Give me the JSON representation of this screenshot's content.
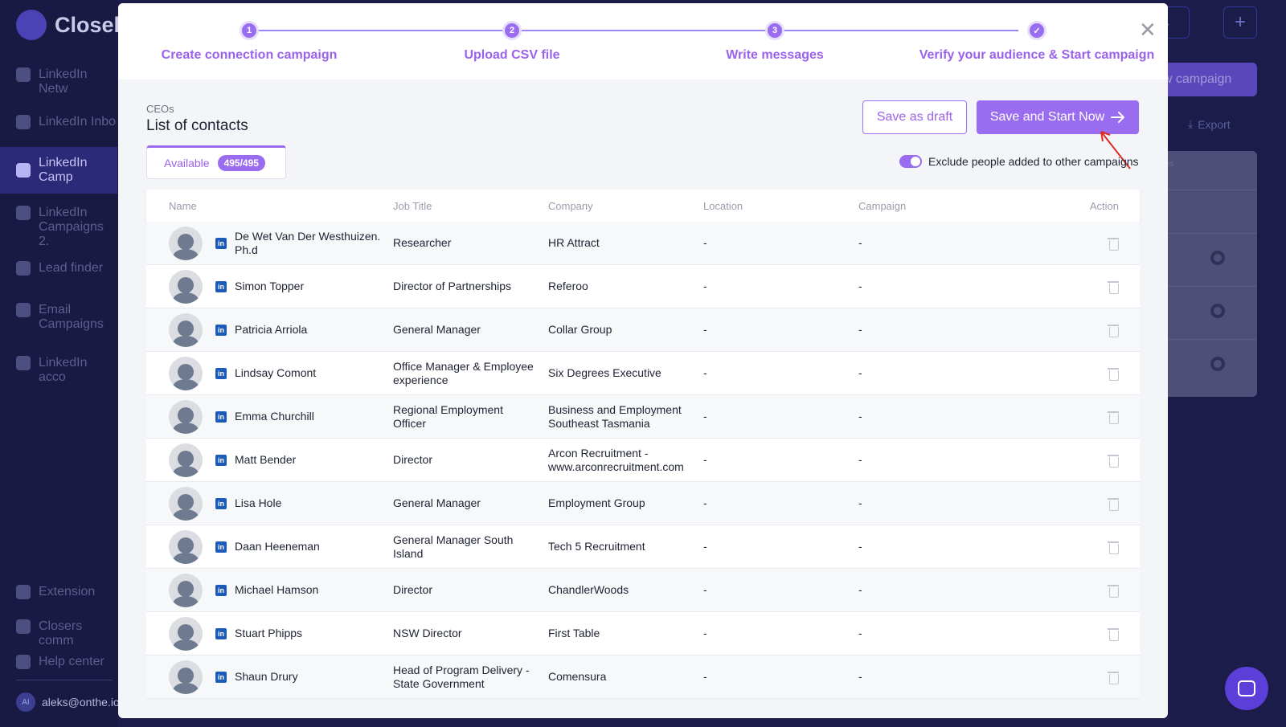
{
  "app": {
    "logo_text": "Closel"
  },
  "sidebar": {
    "items": [
      {
        "label": "LinkedIn Netw"
      },
      {
        "label": "LinkedIn Inbo"
      },
      {
        "label": "LinkedIn Camp"
      },
      {
        "label": "LinkedIn Campaigns 2."
      },
      {
        "label": "Lead finder"
      },
      {
        "label": "Email Campaigns"
      },
      {
        "label": "LinkedIn acco"
      },
      {
        "label": "Extension"
      },
      {
        "label": "Closers comm"
      },
      {
        "label": "Help center"
      }
    ],
    "user": {
      "initials": "AI",
      "email": "aleks@onthe.io"
    }
  },
  "background": {
    "new_campaign_label": "ew campaign",
    "export_label": "Export",
    "card_text": "sages\nded"
  },
  "stepper": {
    "steps": [
      {
        "number": "1",
        "label": "Create connection campaign"
      },
      {
        "number": "2",
        "label": "Upload CSV file"
      },
      {
        "number": "3",
        "label": "Write messages"
      },
      {
        "number": "✓",
        "label": "Verify your audience & Start campaign"
      }
    ]
  },
  "list": {
    "category": "CEOs",
    "title": "List of contacts",
    "tab_label": "Available",
    "tab_count": "495/495"
  },
  "actions": {
    "save_draft": "Save as draft",
    "save_start": "Save and Start Now",
    "exclude_label": "Exclude people added to other campaigns",
    "exclude_enabled": true
  },
  "colors": {
    "accent": "#9a6cf0",
    "linkedin": "#1e5bb8",
    "annotation_arrow": "#e02b20"
  },
  "table": {
    "headers": {
      "name": "Name",
      "job": "Job Title",
      "company": "Company",
      "location": "Location",
      "campaign": "Campaign",
      "action": "Action"
    },
    "rows": [
      {
        "name": "De Wet Van Der Westhuizen. Ph.d",
        "job": "Researcher",
        "company": "HR Attract",
        "location": "-",
        "campaign": "-"
      },
      {
        "name": "Simon Topper",
        "job": "Director of Partnerships",
        "company": "Referoo",
        "location": "-",
        "campaign": "-"
      },
      {
        "name": "Patricia Arriola",
        "job": "General Manager",
        "company": "Collar Group",
        "location": "-",
        "campaign": "-"
      },
      {
        "name": "Lindsay Comont",
        "job": "Office Manager & Employee experience",
        "company": "Six Degrees Executive",
        "location": "-",
        "campaign": "-"
      },
      {
        "name": "Emma Churchill",
        "job": "Regional Employment Officer",
        "company": "Business and Employment Southeast Tasmania",
        "location": "-",
        "campaign": "-"
      },
      {
        "name": "Matt Bender",
        "job": "Director",
        "company": "Arcon Recruitment - www.arconrecruitment.com",
        "location": "-",
        "campaign": "-"
      },
      {
        "name": "Lisa Hole",
        "job": "General Manager",
        "company": "Employment Group",
        "location": "-",
        "campaign": "-"
      },
      {
        "name": "Daan Heeneman",
        "job": "General Manager South Island",
        "company": "Tech 5 Recruitment",
        "location": "-",
        "campaign": "-"
      },
      {
        "name": "Michael Hamson",
        "job": "Director",
        "company": "ChandlerWoods",
        "location": "-",
        "campaign": "-"
      },
      {
        "name": "Stuart Phipps",
        "job": "NSW Director",
        "company": "First Table",
        "location": "-",
        "campaign": "-"
      },
      {
        "name": "Shaun Drury",
        "job": "Head of Program Delivery - State Government",
        "company": "Comensura",
        "location": "-",
        "campaign": "-"
      }
    ]
  }
}
